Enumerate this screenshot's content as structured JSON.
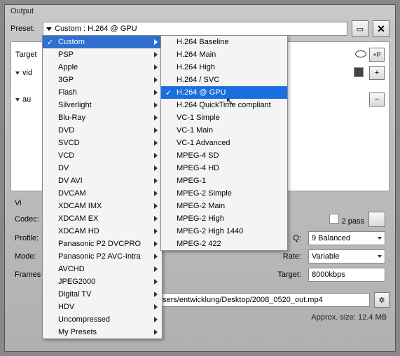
{
  "window_title": "Output",
  "preset": {
    "label": "Preset:",
    "value": "Custom : H.264 @ GPU"
  },
  "target_label": "Target",
  "tree": [
    "vid",
    "au"
  ],
  "plus_p": "+P",
  "video_sec": "Vi",
  "fields": {
    "codec": "Codec:",
    "profile": "Profile:",
    "mode": "Mode:",
    "frames": "Frames",
    "q": "Q:",
    "rate": "Rate:",
    "target": "Target:"
  },
  "two_pass": "2 pass",
  "q_value": "9  Balanced",
  "rate_value": "Variable",
  "target_value": "8000kbps",
  "path": "C:/Users/entwicklung/Desktop/2008_0520_out.mp4",
  "approx": "Approx. size: 12.4 MB",
  "menu1": [
    "Custom",
    "PSP",
    "Apple",
    "3GP",
    "Flash",
    "Silverlight",
    "Blu-Ray",
    "DVD",
    "SVCD",
    "VCD",
    "DV",
    "DV AVI",
    "DVCAM",
    "XDCAM IMX",
    "XDCAM EX",
    "XDCAM HD",
    "Panasonic P2 DVCPRO",
    "Panasonic P2 AVC-Intra",
    "AVCHD",
    "JPEG2000",
    "Digital TV",
    "HDV",
    "Uncompressed",
    "My Presets"
  ],
  "menu2": [
    "H.264 Baseline",
    "H.264 Main",
    "H.264 High",
    "H.264 / SVC",
    "H.264 @ GPU",
    "H.264 QuickTime compliant",
    "VC-1 Simple",
    "VC-1 Main",
    "VC-1 Advanced",
    "MPEG-4 SD",
    "MPEG-4 HD",
    "MPEG-1",
    "MPEG-2 Simple",
    "MPEG-2 Main",
    "MPEG-2 High",
    "MPEG-2 High 1440",
    "MPEG-2 422"
  ],
  "menu1_selected_index": 0,
  "menu2_selected_index": 4
}
